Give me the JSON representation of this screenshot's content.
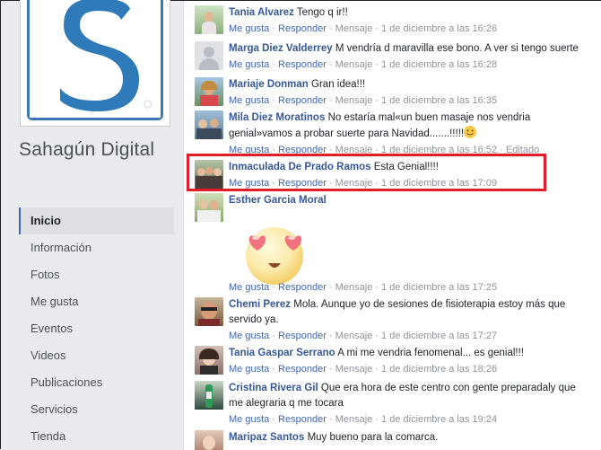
{
  "page": {
    "name": "Sahagún Digital",
    "nav": [
      "Inicio",
      "Información",
      "Fotos",
      "Me gusta",
      "Eventos",
      "Videos",
      "Publicaciones",
      "Servicios",
      "Tienda"
    ]
  },
  "actions": {
    "like": "Me gusta",
    "reply": "Responder",
    "message": "Mensaje",
    "edited": "Editado",
    "sep": "·"
  },
  "comments": [
    {
      "author": "Tania Alvarez",
      "text": "Tengo q ir!!",
      "time": "1 de diciembre a las 16:26"
    },
    {
      "author": "Marga Diez Valderrey",
      "text": "M vendría d maravilla ese bono. A ver si tengo suerte",
      "time": "1 de diciembre a las 16:28"
    },
    {
      "author": "Mariaje Donman",
      "text": "Gran idea!!!",
      "time": "1 de diciembre a las 16:35"
    },
    {
      "author": "Mila Diez Moratinos",
      "text": "No estaría mal«un buen masaje nos vendria genial»vamos a probar suerte para Navidad.......!!!!!",
      "time": "1 de diciembre a las 16:52"
    },
    {
      "author": "Inmaculada De Prado Ramos",
      "text": "Esta Genial!!!!",
      "time": "1 de diciembre a las 17:09"
    },
    {
      "author": "Esther Garcia Moral",
      "text": "",
      "time": "1 de diciembre a las 17:25"
    },
    {
      "author": "Chemi Perez",
      "text": "Mola. Aunque yo de sesiones de fisioterapia estoy más que servido ya.",
      "time": "1 de diciembre a las 17:27"
    },
    {
      "author": "Tania Gaspar Serrano",
      "text": "A mi me vendria fenomenal... es genial!!!",
      "time": "1 de diciembre a las 18:26"
    },
    {
      "author": "Cristina Rivera Gil",
      "text": "Que era hora de este centro con gente preparadaly que me alegraria q me tocara",
      "time": "1 de diciembre a las 19:24"
    },
    {
      "author": "Maripaz Santos",
      "text": "Muy bueno para la comarca."
    }
  ],
  "colors": {
    "accent": "#4267b2",
    "author": "#365899",
    "highlight": "#e11d2a",
    "logo": "#2f7ab8"
  },
  "icons": {
    "logo": "letter-s-logo",
    "smiley": "smiley-emoji",
    "sticker": "heart-eyes-sticker"
  }
}
